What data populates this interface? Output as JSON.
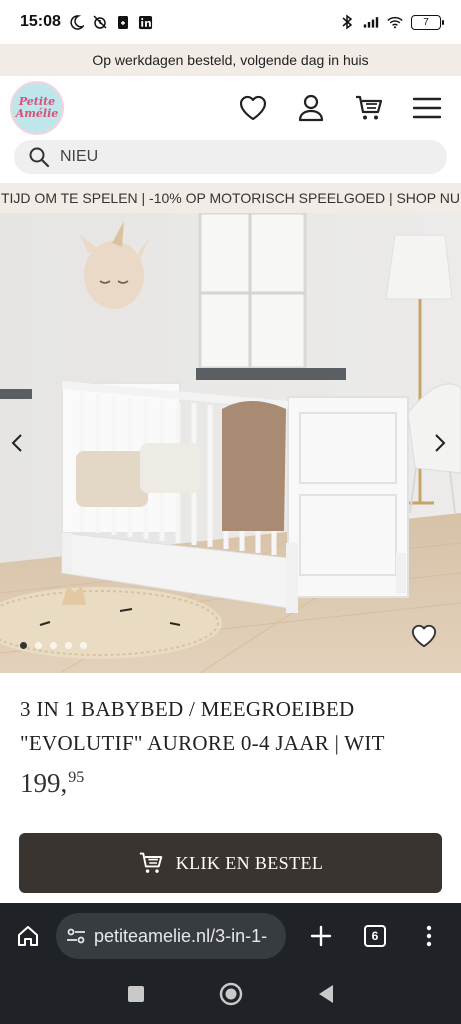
{
  "status_bar": {
    "time": "15:08",
    "battery": "7"
  },
  "promo_bar": {
    "text": "Op werkdagen besteld, volgende dag in huis"
  },
  "header": {
    "logo_text_line1": "Petite",
    "logo_text_line2": "Amélie",
    "icons": [
      "heart-icon",
      "user-icon",
      "cart-icon",
      "menu-icon"
    ]
  },
  "search": {
    "placeholder": "NIEU",
    "value": ""
  },
  "marquee": {
    "text": "TIJD OM TE SPELEN | -10% OP MOTORISCH SPEELGOED | SHOP NU"
  },
  "gallery": {
    "slide_count": 5,
    "active_slide": 1
  },
  "product": {
    "title": "3 IN 1 BABYBED / MEEGROEIBED \"EVOLUTIF\" AURORE 0-4 JAAR | WIT",
    "price_main": "199,",
    "price_cents": "95",
    "buy_label": "KLIK EN BESTEL"
  },
  "browser": {
    "url": "petiteamelie.nl/3-in-1-",
    "tab_count": "6"
  },
  "colors": {
    "promo_bg": "#f1ece6",
    "button_bg": "#3a3431",
    "browser_bg": "#1f2327",
    "logo_bg": "#bfe6ea",
    "logo_text": "#d9507a"
  }
}
